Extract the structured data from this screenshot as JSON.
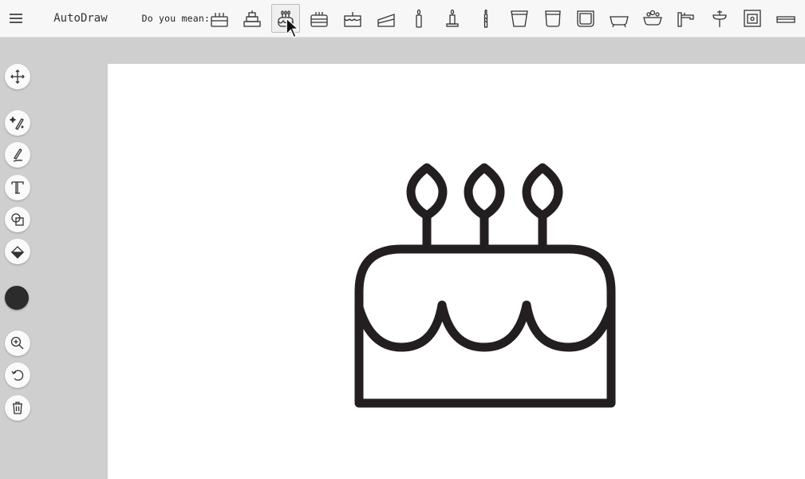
{
  "app": {
    "title": "AutoDraw"
  },
  "toolbar": {
    "suggest_label": "Do you mean:",
    "suggestions": [
      {
        "icon": "cake-icon"
      },
      {
        "icon": "tiered-cake-icon"
      },
      {
        "icon": "birthday-cake-icon",
        "selected": true
      },
      {
        "icon": "layer-cake-icon"
      },
      {
        "icon": "cake-slice-icon"
      },
      {
        "icon": "cake-wedge-icon"
      },
      {
        "icon": "candle-icon"
      },
      {
        "icon": "candle-holder-icon"
      },
      {
        "icon": "thin-candle-icon"
      },
      {
        "icon": "bucket-icon"
      },
      {
        "icon": "pot-icon"
      },
      {
        "icon": "container-icon"
      },
      {
        "icon": "bathtub-icon"
      },
      {
        "icon": "bubble-bath-icon"
      },
      {
        "icon": "faucet-icon"
      },
      {
        "icon": "sink-icon"
      },
      {
        "icon": "oven-icon"
      },
      {
        "icon": "tray-icon"
      }
    ]
  },
  "sidebar": {
    "tools": [
      {
        "name": "move-tool",
        "icon": "move-icon"
      },
      {
        "name": "autodraw-tool",
        "icon": "magic-pen-icon"
      },
      {
        "name": "draw-tool",
        "icon": "pen-icon"
      },
      {
        "name": "text-tool",
        "icon": "text-icon"
      },
      {
        "name": "shape-tool",
        "icon": "shapes-icon"
      },
      {
        "name": "fill-tool",
        "icon": "paint-bucket-icon"
      },
      {
        "name": "zoom-tool",
        "icon": "zoom-in-icon"
      },
      {
        "name": "undo-tool",
        "icon": "undo-icon"
      },
      {
        "name": "delete-tool",
        "icon": "trash-icon"
      }
    ],
    "current_color": "#2c2c2c"
  },
  "canvas": {
    "drawing": "birthday-cake-icon",
    "stroke_color": "#231f20",
    "background": "#ffffff"
  },
  "colors": {
    "topbar": "#f7f7f7",
    "workspace": "#cfcfcf",
    "icon": "#333333"
  }
}
